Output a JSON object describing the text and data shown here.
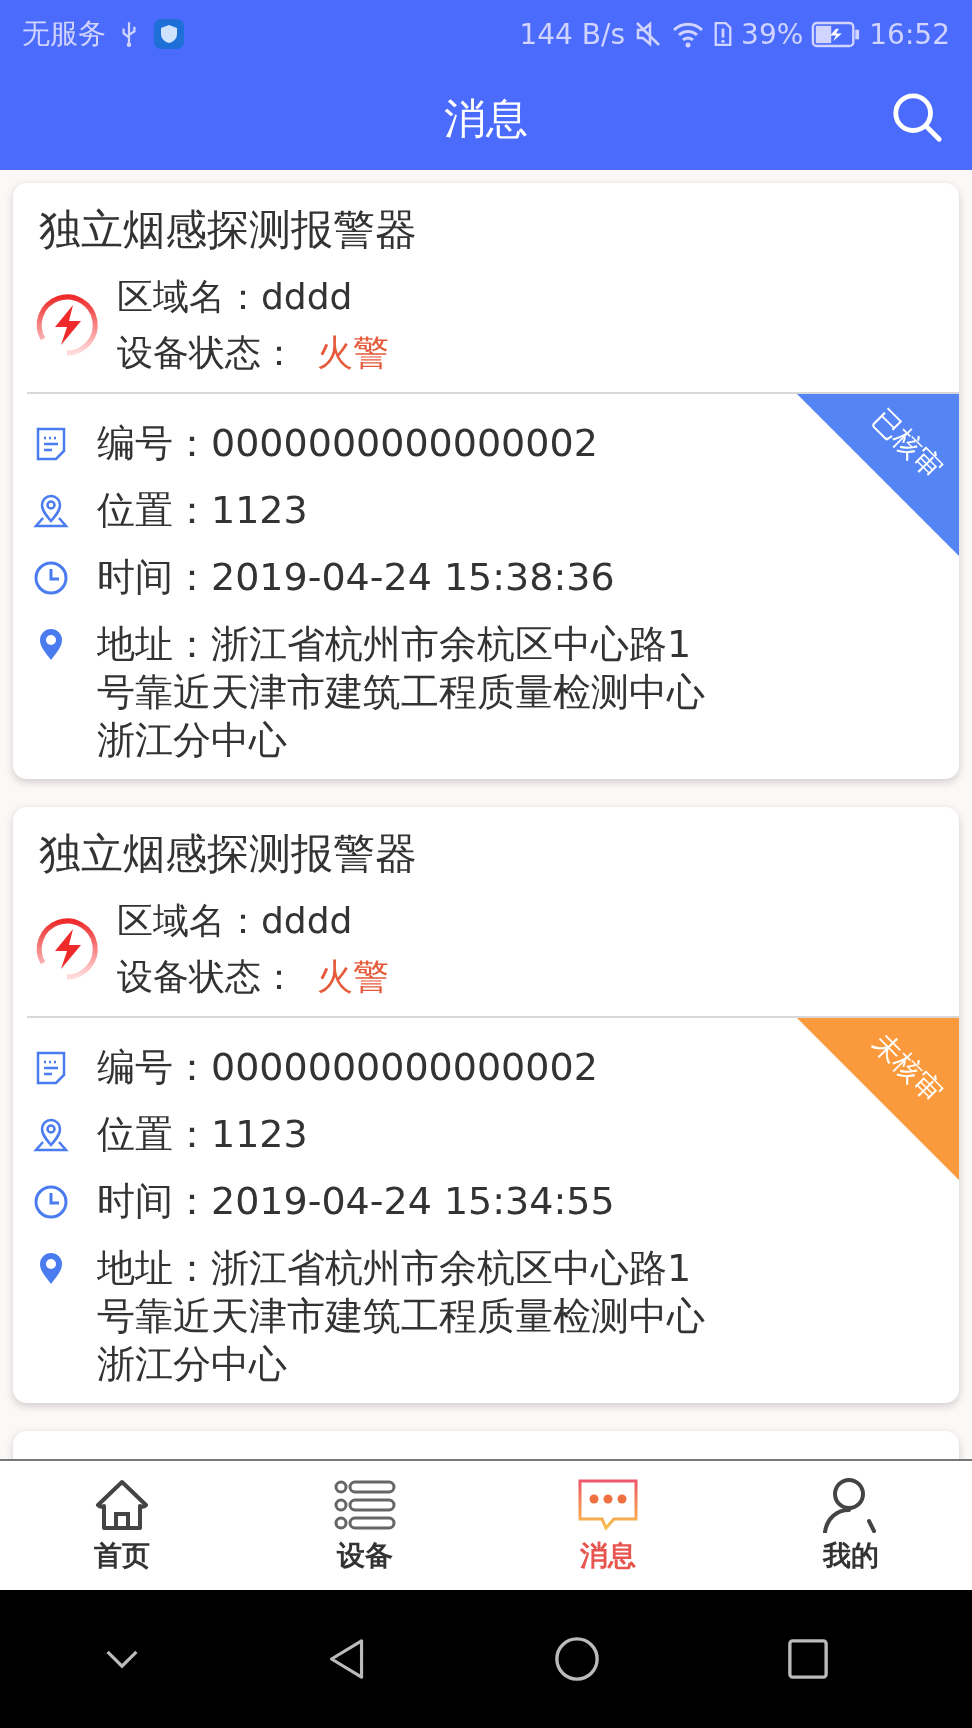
{
  "status_bar": {
    "carrier": "无服务",
    "speed": "144 B/s",
    "battery": "39%",
    "time": "16:52"
  },
  "header": {
    "title": "消息"
  },
  "messages": [
    {
      "title": "独立烟感探测报警器",
      "area_label": "区域名：",
      "area": "dddd",
      "state_label": "设备状态：",
      "state": "火警",
      "reviewed": true,
      "badge": "已核审",
      "fields": [
        {
          "kind": "number",
          "text": "编号：0000000000000002"
        },
        {
          "kind": "location",
          "text": "位置：1123"
        },
        {
          "kind": "time",
          "text": "时间：2019-04-24 15:38:36"
        },
        {
          "kind": "address",
          "text": "地址：浙江省杭州市余杭区中心路1号靠近天津市建筑工程质量检测中心浙江分中心"
        }
      ]
    },
    {
      "title": "独立烟感探测报警器",
      "area_label": "区域名：",
      "area": "dddd",
      "state_label": "设备状态：",
      "state": "火警",
      "reviewed": false,
      "badge": "未核审",
      "fields": [
        {
          "kind": "number",
          "text": "编号：0000000000000002"
        },
        {
          "kind": "location",
          "text": "位置：1123"
        },
        {
          "kind": "time",
          "text": "时间：2019-04-24 15:34:55"
        },
        {
          "kind": "address",
          "text": "地址：浙江省杭州市余杭区中心路1号靠近天津市建筑工程质量检测中心浙江分中心"
        }
      ]
    }
  ],
  "tabs": [
    {
      "kind": "home",
      "label": "首页",
      "selected": false
    },
    {
      "kind": "devices",
      "label": "设备",
      "selected": false
    },
    {
      "kind": "messages",
      "label": "消息",
      "selected": true
    },
    {
      "kind": "me",
      "label": "我的",
      "selected": false
    }
  ]
}
